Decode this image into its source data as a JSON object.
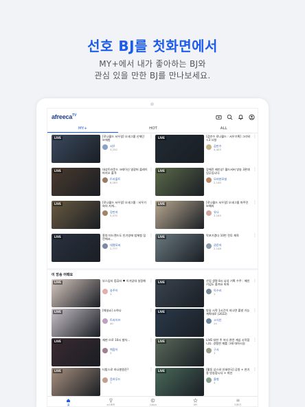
{
  "promo": {
    "title": "선호 BJ를 첫화면에서",
    "line1": "MY+에서 내가 좋아하는 BJ와",
    "line2": "관심 있을 만한 BJ를 만나보세요."
  },
  "app": {
    "logo": "afreeca",
    "logo_sup": "TV",
    "icons": [
      "broadcast-icon",
      "search-icon",
      "bell-icon",
      "profile-icon"
    ]
  },
  "tabs": [
    {
      "label": "MY+",
      "active": true
    },
    {
      "label": "HOT",
      "active": false
    },
    {
      "label": "ALL",
      "active": false
    }
  ],
  "live_badge": "LIVE",
  "more_glyph": "⋮",
  "section": {
    "title": "이 방송 어때요"
  },
  "cards_top": [
    {
      "title": "[로나월드 서우걸] 오새그룹 신체단 보체험",
      "nick": "서우",
      "views": "3,232",
      "thumb": "#3a4a5e",
      "avatar": "#8aa0c8"
    },
    {
      "title": "[감만수 로나월드 : 서우기획] 그리워 <3 시청",
      "nick": "감만수",
      "views": "4,403",
      "thumb": "#202a33",
      "avatar": "#c4b28a"
    },
    {
      "title": "대상트라운드 크래이신 영광머 플레이마지오 출격",
      "nick": "트라볼트",
      "views": "6,183",
      "thumb": "#4a3a2e",
      "avatar": "#9a7c64"
    },
    {
      "title": "강해진 제인상! 월드서버 방송 3관대 업무입니다.",
      "nick": "모여현모빌",
      "views": "2,140",
      "thumb": "#5c6a4a",
      "avatar": "#b98a6a"
    },
    {
      "title": "[로나월드 서우걸] 오새그룹 : 서우기회의 지게...",
      "nick": "강만지",
      "views": "5,070",
      "thumb": "#6a5a40",
      "avatar": "#a0846a"
    },
    {
      "title": "[로나월드 서우걸] 오새그룹 마주민 보예지",
      "nick": "유나",
      "views": "3,163",
      "thumb": "#b8a890",
      "avatar": "#d0a8a0"
    },
    {
      "title": "흥원 미드랜드도 인기방에 법체험 짐전에서...",
      "nick": "대열모씨",
      "views": "2,777",
      "thumb": "#2a3240",
      "avatar": "#7a8aa0"
    },
    {
      "title": "막포기겠다 10번 전투 체육",
      "nick": "권준의",
      "views": "2,148",
      "thumb": "#6a7a80",
      "avatar": "#8a9aa8"
    }
  ],
  "cards_bottom": [
    {
      "title": "부스입지 컴퓨터 ♥ 이거있대 실정해",
      "nick": "송주이",
      "views": "1",
      "thumb": "#d8c8c0",
      "avatar": "#e0b0b0"
    },
    {
      "title": "산업 생명 8시 남성 기획 수주 : 메인 기념도 즐겨요 마마",
      "nick": "독수리",
      "views": "1",
      "thumb": "#3a4450",
      "avatar": "#7a8a9a"
    },
    {
      "title": "[채널쇼] 소하나",
      "nick": "트라이브",
      "views": "40",
      "thumb": "#c8c0c8",
      "avatar": "#c0a0c0"
    },
    {
      "title": "방송 시작 1시간이 지나면 출발 가능 계획대로 (2022)",
      "nick": "고식인",
      "views": "24",
      "thumb": "#2a3a4a",
      "avatar": "#6a8aa0"
    },
    {
      "title": "재현 으로 10시 발차...",
      "nick": "백합이",
      "views": "3",
      "thumb": "#3a2a30",
      "avatar": "#a08090"
    },
    {
      "title": "LIVE 대한 주 어디 관련 게임 시작합니다. 경험한 채를 그래 대하시길",
      "nick": "구사",
      "views": "3",
      "thumb": "#5a6a5a",
      "avatar": "#9aa08a"
    },
    {
      "title": "티밤스로 하나봉원준?",
      "nick": "음하무드",
      "views": "7",
      "thumb": "#a89080",
      "avatar": "#c0a090"
    },
    {
      "title": "[활동 상스와 인쇄한국] 공원 + 연기용 방송합니다 + 마인",
      "nick": "울형",
      "views": "4",
      "thumb": "#4a6a5a",
      "avatar": "#8aa090"
    }
  ],
  "bottom_nav": [
    {
      "label": "홈",
      "icon": "home-icon",
      "active": true
    },
    {
      "label": "e스포츠",
      "icon": "trophy-icon",
      "active": false
    },
    {
      "label": "Catch",
      "icon": "catch-icon",
      "active": false
    },
    {
      "label": "MY",
      "icon": "star-icon",
      "active": false
    },
    {
      "label": "더보기",
      "icon": "menu-icon",
      "active": false
    }
  ],
  "colors": {
    "accent": "#1e5de9",
    "background": "#f1f3f6"
  }
}
